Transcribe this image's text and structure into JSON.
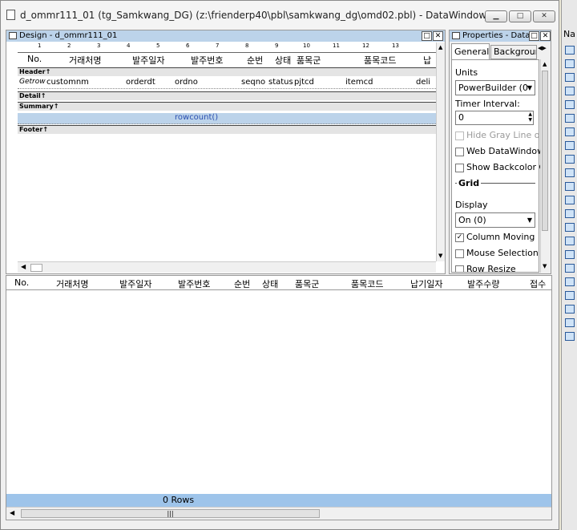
{
  "window": {
    "title": "d_ommr111_01  (tg_Samkwang_DG) (z:\\frienderp40\\pbl\\samkwang_dg\\omd02.pbl) - DataWindow"
  },
  "design": {
    "title": "Design - d_ommr111_01",
    "ruler": [
      "1",
      "2",
      "3",
      "4",
      "5",
      "6",
      "7",
      "8",
      "9",
      "10",
      "11",
      "12",
      "13"
    ],
    "headers": [
      "No.",
      "거래처명",
      "발주일자",
      "발주번호",
      "순번",
      "상태",
      "품목군",
      "품목코드",
      "납"
    ],
    "bands": {
      "header": "Header↑",
      "detail": "Detail↑",
      "summary": "Summary↑",
      "footer": "Footer↑"
    },
    "detail_fields": [
      "Getrow",
      "customnm",
      "orderdt",
      "ordno",
      "seqno",
      "status",
      "pjtcd",
      "itemcd",
      "deli"
    ],
    "summary_expr": "rowcount()"
  },
  "properties": {
    "title": "Properties - DataW",
    "tabs": [
      "General",
      "Background"
    ],
    "units_label": "Units",
    "units_value": "PowerBuilder (0",
    "timer_label": "Timer Interval:",
    "timer_value": "0",
    "checkboxes": [
      {
        "label": "Hide Gray Line on",
        "checked": false,
        "disabled": true
      },
      {
        "label": "Web DataWindow",
        "checked": false
      },
      {
        "label": "Show Backcolor O",
        "checked": false
      }
    ],
    "grid_label": "Grid",
    "display_label": "Display",
    "display_value": "On (0)",
    "grid_checks": [
      {
        "label": "Column Moving",
        "checked": true
      },
      {
        "label": "Mouse Selection",
        "checked": false
      },
      {
        "label": "Row Resize",
        "checked": false
      }
    ]
  },
  "preview": {
    "headers": [
      "No.",
      "거래처명",
      "발주일자",
      "발주번호",
      "순번",
      "상태",
      "품목군",
      "품목코드",
      "납기일자",
      "발주수량",
      "접수"
    ],
    "status": "0 Rows"
  },
  "side": {
    "tab_label": "Na"
  }
}
